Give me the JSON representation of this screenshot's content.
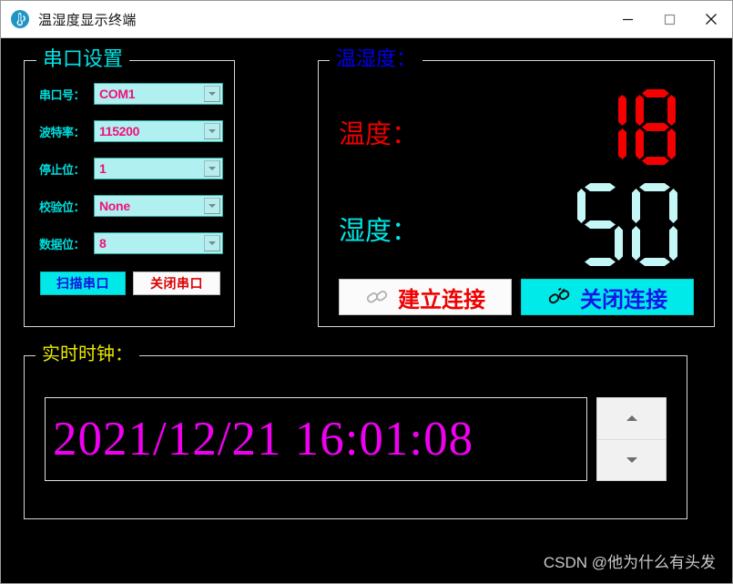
{
  "window": {
    "title": "温湿度显示终端",
    "icon": "thermometer-icon",
    "minimize_label": "—",
    "maximize_label": "□",
    "close_label": "✕",
    "background": "#000000"
  },
  "serial_group": {
    "legend": "串口设置",
    "legend_color": "#00e5e5",
    "fields": [
      {
        "label": "串口号：",
        "value": "COM1"
      },
      {
        "label": "波特率：",
        "value": "115200"
      },
      {
        "label": "停止位：",
        "value": "1"
      },
      {
        "label": "校验位：",
        "value": "None"
      },
      {
        "label": "数据位：",
        "value": "8"
      }
    ],
    "scan_button": "扫描串口",
    "close_button": "关闭串口"
  },
  "th_group": {
    "legend": "温湿度：",
    "legend_color": "#0000ee",
    "temperature_label": "温度：",
    "temperature_value": "18",
    "temperature_color": "#f40000",
    "humidity_label": "湿度：",
    "humidity_value": "50",
    "humidity_color": "#c6f7f7",
    "connect_button": "建立连接",
    "disconnect_button": "关闭连接"
  },
  "clock_group": {
    "legend": "实时时钟：",
    "legend_color": "#e8e800",
    "datetime": "2021/12/21  16:01:08",
    "datetime_color": "#f000f0",
    "spin_up": "▲",
    "spin_down": "▼"
  },
  "watermark": "CSDN @他为什么有头发"
}
